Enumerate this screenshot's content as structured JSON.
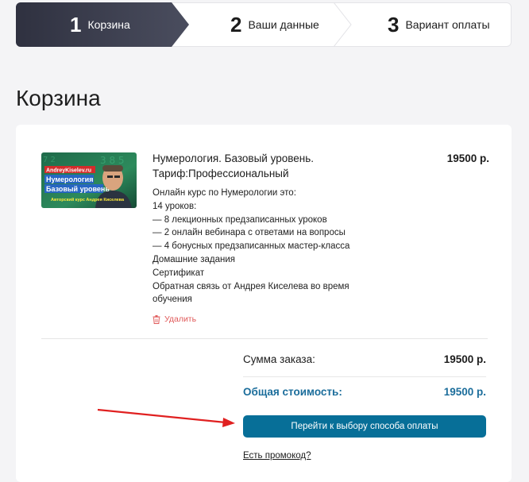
{
  "steps": [
    {
      "num": "1",
      "label": "Корзина"
    },
    {
      "num": "2",
      "label": "Ваши данные"
    },
    {
      "num": "3",
      "label": "Вариант оплаты"
    }
  ],
  "page": {
    "title": "Корзина"
  },
  "product": {
    "title_line1": "Нумерология. Базовый уровень.",
    "title_line2": "Тариф:Профессиональный",
    "price": "19500 р.",
    "thumb": {
      "site": "AndreyKiselev.ru",
      "line1": "Нумерология",
      "line2": "Базовый уровень",
      "author": "Авторский курс Андрея Киселева"
    },
    "description": [
      "Онлайн курс по Нумерологии это:",
      "14 уроков:",
      "— 8 лекционных предзаписанных уроков",
      "— 2 онлайн вебинара с ответами на вопросы",
      "— 4 бонусных предзаписанных мастер-класса",
      "Домашние задания",
      "Сертификат",
      "Обратная связь от Андрея Киселева во время",
      "обучения"
    ],
    "delete_label": "Удалить"
  },
  "summary": {
    "order_sum_label": "Сумма заказа:",
    "order_sum_value": "19500 р.",
    "total_label": "Общая стоимость:",
    "total_value": "19500 р."
  },
  "actions": {
    "pay_button": "Перейти к выбору способа оплаты",
    "promo_link": "Есть промокод?"
  },
  "colors": {
    "step_active": "#3b3e4d",
    "accent": "#076f98",
    "total_text": "#1b6d9b",
    "delete": "#e05a5a",
    "arrow": "#e02020"
  },
  "icons": {
    "delete": "trash-icon",
    "annotation": "arrow-icon"
  }
}
